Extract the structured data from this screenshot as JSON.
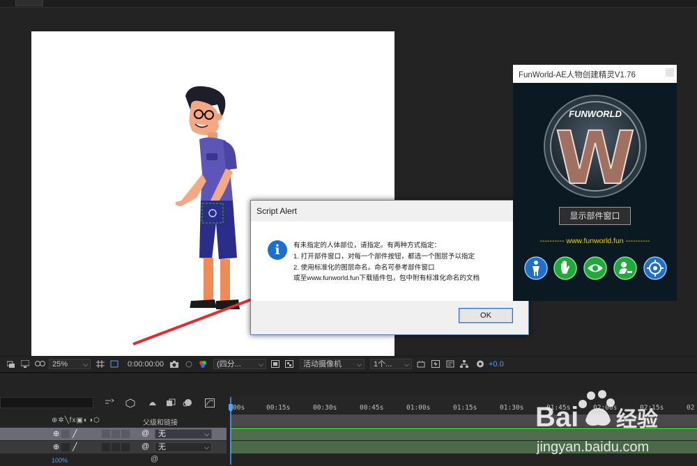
{
  "viewer": {
    "zoom": "25%",
    "timecode": "0:00:00:00",
    "resolution": "(四分...",
    "camera": "活动摄像机",
    "views": "1个...",
    "exposure": "+0.0"
  },
  "timeline": {
    "header_parent": "父级和链接",
    "layers": [
      {
        "parent": "无"
      },
      {
        "parent": "无"
      }
    ],
    "opacity_readout": "100%",
    "ruler_ticks": [
      "00s",
      "00:15s",
      "00:30s",
      "00:45s",
      "01:00s",
      "01:15s",
      "01:30s",
      "01:45s",
      "02:00s",
      "02:15s",
      "02"
    ]
  },
  "dialog": {
    "title": "Script Alert",
    "close": "✕",
    "lines": [
      "有未指定的人体部位，请指定。有两种方式指定：",
      "1. 打开部件窗口，对每一个部件按钮，都选一个图层予以指定",
      "2. 使用标准化的图层命名。命名可参考部件窗口",
      "或至www.funworld.fun下载插件包，包中附有标准化命名的文档"
    ],
    "ok_label": "OK",
    "info_glyph": "i"
  },
  "plugin_panel": {
    "title": "FunWorld-AE人物创建精灵V1.76",
    "logo_text": "FUNWORLD",
    "logo_letter": "W",
    "show_button": "显示部件窗口",
    "website": "----------   www.funworld.fun   ----------",
    "buttons": [
      "person-icon",
      "hand-icon",
      "eye-icon",
      "user-add-icon",
      "target-icon"
    ]
  },
  "watermark": {
    "brand": "Bai",
    "brand2": "经验",
    "url": "jingyan.baidu.com"
  },
  "colors": {
    "accent_blue": "#2a6fd0",
    "green_button": "#1faa3a",
    "blue_button": "#1f6fc9",
    "website_yellow": "#e8d000"
  }
}
